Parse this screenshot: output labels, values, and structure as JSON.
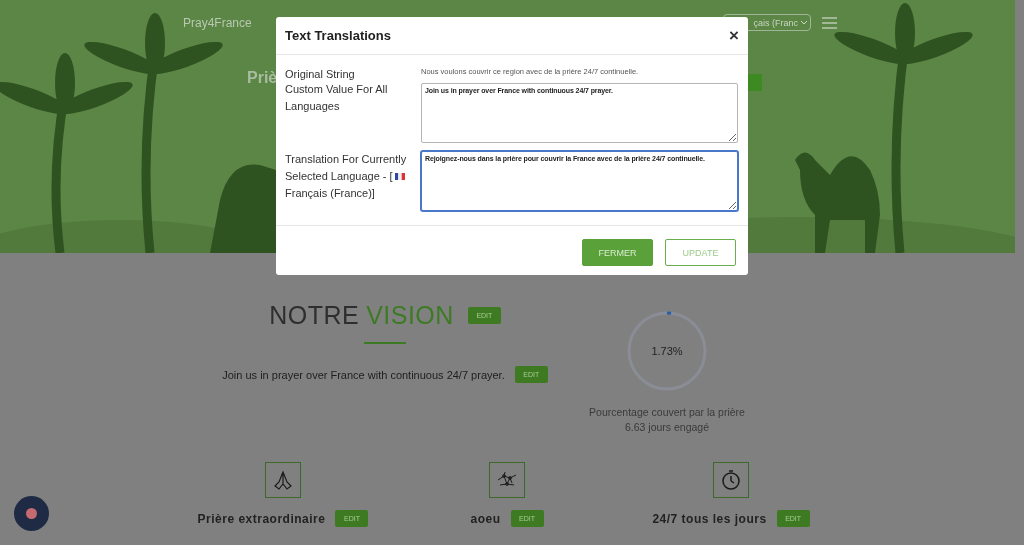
{
  "header": {
    "brand": "Pray4France",
    "language_select": "çais (Franc"
  },
  "hero": {
    "title": "Priè"
  },
  "modal": {
    "title": "Text Translations",
    "close": "×",
    "original": {
      "label": "Original String",
      "value": "Nous voulons couvrir ce region avec de la prière 24/7 continuelle."
    },
    "fields": [
      {
        "label_lines": [
          "Custom Value For All Languages"
        ],
        "value": "Join us in prayer over France with continuous 24/7 prayer.",
        "focused": false
      },
      {
        "label_lines": [
          "Translation For Currently",
          "Selected Language - ["
        ],
        "label_after": "Français (France)]",
        "value": "Rejoignez-nous dans la prière pour couvrir la France avec de la prière 24/7 continuelle.",
        "focused": true
      }
    ],
    "buttons": [
      {
        "label": "FERMER",
        "kind": "primary"
      },
      {
        "label": "UPDATE",
        "kind": "outline"
      }
    ]
  },
  "vision": {
    "heading_dark": "NOTRE",
    "heading_accent": "VISION",
    "heading_edit": "EDIT",
    "text": "Join us in prayer over France with continuous 24/7 prayer.",
    "text_edit": "EDIT"
  },
  "progress": {
    "level": 0.0173,
    "reading": "1.73%",
    "caption": "Pourcentage couvert par la prière",
    "days": "6.63 jours engagé"
  },
  "features": [
    {
      "kind": "hands",
      "label": "Prière extraordinaire",
      "edit": "EDIT"
    },
    {
      "kind": "network",
      "label": "aoeu",
      "edit": "EDIT"
    },
    {
      "kind": "stopwatch",
      "label": "24/7 tous les jours",
      "edit": "EDIT"
    }
  ]
}
